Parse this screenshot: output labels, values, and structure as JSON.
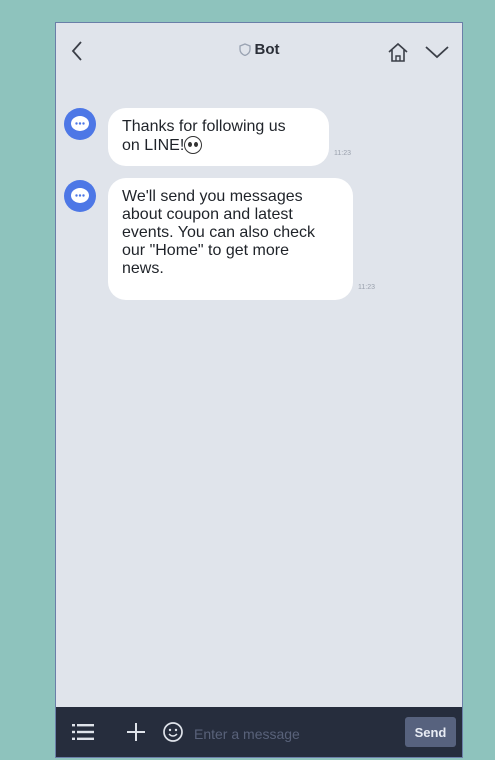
{
  "header": {
    "title": "Bot"
  },
  "messages": [
    {
      "text_line1": "Thanks for following us",
      "text_line2": "on LINE!",
      "time": "11:23"
    },
    {
      "lines": [
        "We'll send you messages",
        "about coupon and latest",
        "events. You can also check",
        "our \"Home\" to get more",
        "news."
      ],
      "time": "11:23"
    }
  ],
  "input_bar": {
    "placeholder": "Enter a message",
    "send_label": "Send"
  },
  "colors": {
    "avatar": "#4d77e6",
    "input_bar_bg": "#262d3d",
    "chat_bg": "#e0e4eb"
  }
}
